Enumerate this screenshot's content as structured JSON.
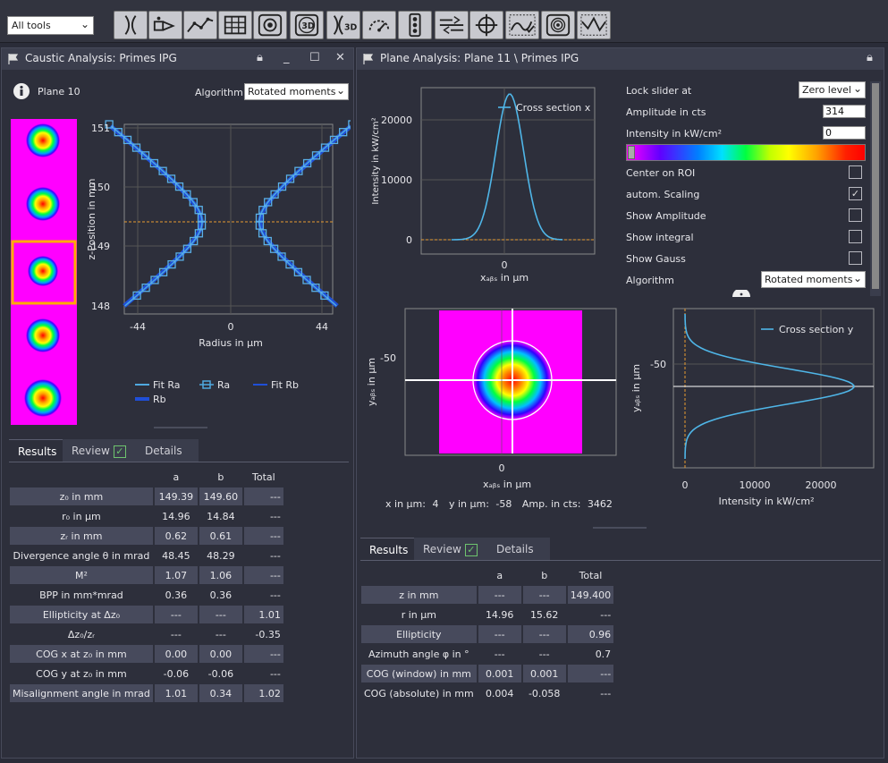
{
  "toolbar": {
    "select_value": "All tools",
    "buttons": [
      "caustic-icon",
      "beam-path-icon",
      "line-chart-icon",
      "table-icon",
      "target-icon",
      "3d-view-icon",
      "caustic-3d-icon",
      "gauge-icon",
      "traffic-light-icon",
      "alignment-icon",
      "crosshair-icon",
      "histogram-check-icon",
      "rings-icon",
      "profile-wave-icon"
    ]
  },
  "caustic": {
    "title": "Caustic Analysis: Primes IPG",
    "plane_label": "Plane 10",
    "algorithm_label": "Algorithm",
    "algorithm_value": "Rotated moments",
    "plot": {
      "ylabel": "z-Position in mm",
      "xlabel": "Radius in µm",
      "yticks": [
        "151",
        "150",
        "149",
        "148"
      ],
      "xticks": [
        "-44",
        "0",
        "44"
      ]
    },
    "legend": [
      "Fit Ra",
      "Ra",
      "Fit Rb",
      "Rb"
    ],
    "tabs": [
      "Results",
      "Review",
      "Details"
    ],
    "table": {
      "headers": [
        "",
        "a",
        "b",
        "Total"
      ],
      "rows": [
        [
          "z₀ in mm",
          "149.39",
          "149.60",
          "---"
        ],
        [
          "r₀ in µm",
          "14.96",
          "14.84",
          "---"
        ],
        [
          "zᵣ in mm",
          "0.62",
          "0.61",
          "---"
        ],
        [
          "Divergence angle θ in mrad",
          "48.45",
          "48.29",
          "---"
        ],
        [
          "M²",
          "1.07",
          "1.06",
          "---"
        ],
        [
          "BPP in mm*mrad",
          "0.36",
          "0.36",
          "---"
        ],
        [
          "Ellipticity at Δz₀",
          "---",
          "---",
          "1.01"
        ],
        [
          "Δz₀/zᵣ",
          "---",
          "---",
          "-0.35"
        ],
        [
          "COG x at z₀ in mm",
          "0.00",
          "0.00",
          "---"
        ],
        [
          "COG y at z₀ in mm",
          "-0.06",
          "-0.06",
          "---"
        ],
        [
          "Misalignment angle in mrad",
          "1.01",
          "0.34",
          "1.02"
        ]
      ]
    }
  },
  "plane": {
    "title": "Plane Analysis: Plane 11 \\ Primes IPG",
    "cross_x": {
      "legend": "Cross section x",
      "ylabel": "Intensity in kW/cm²",
      "xlabel": "xₐᵦₛ in µm",
      "yticks": [
        "20000",
        "10000",
        "0"
      ],
      "xticks": [
        "0"
      ]
    },
    "settings": {
      "lock_slider_label": "Lock slider at",
      "lock_slider_value": "Zero level",
      "amplitude_label": "Amplitude in cts",
      "amplitude_value": "314",
      "intensity_label": "Intensity in kW/cm²",
      "intensity_value": "0",
      "center_roi_label": "Center on ROI",
      "autoscale_label": "autom. Scaling",
      "show_amplitude_label": "Show Amplitude",
      "show_integral_label": "Show integral",
      "show_gauss_label": "Show Gauss",
      "algorithm_label": "Algorithm",
      "algorithm_value": "Rotated moments"
    },
    "beam_image": {
      "ylabel": "yₐᵦₛ in µm",
      "xlabel": "xₐᵦₛ in µm",
      "yticks": [
        "-50"
      ],
      "xticks": [
        "0"
      ]
    },
    "cross_y": {
      "legend": "Cross section y",
      "ylabel": "yₐᵦₛ in µm",
      "xlabel": "Intensity in kW/cm²",
      "yticks": [
        "-50"
      ],
      "xticks": [
        "0",
        "10000",
        "20000"
      ]
    },
    "readout": {
      "x_label": "x in µm:",
      "x_value": "4",
      "y_label": "y in µm:",
      "y_value": "-58",
      "amp_label": "Amp. in cts:",
      "amp_value": "3462"
    },
    "tabs": [
      "Results",
      "Review",
      "Details"
    ],
    "table": {
      "headers": [
        "",
        "a",
        "b",
        "Total"
      ],
      "rows": [
        [
          "z in mm",
          "---",
          "---",
          "149.400"
        ],
        [
          "r in µm",
          "14.96",
          "15.62",
          "---"
        ],
        [
          "Ellipticity",
          "---",
          "---",
          "0.96"
        ],
        [
          "Azimuth angle φ in °",
          "---",
          "---",
          "0.7"
        ],
        [
          "COG (window) in mm",
          "0.001",
          "0.001",
          "---"
        ],
        [
          "COG (absolute) in mm",
          "0.004",
          "-0.058",
          "---"
        ]
      ]
    }
  }
}
